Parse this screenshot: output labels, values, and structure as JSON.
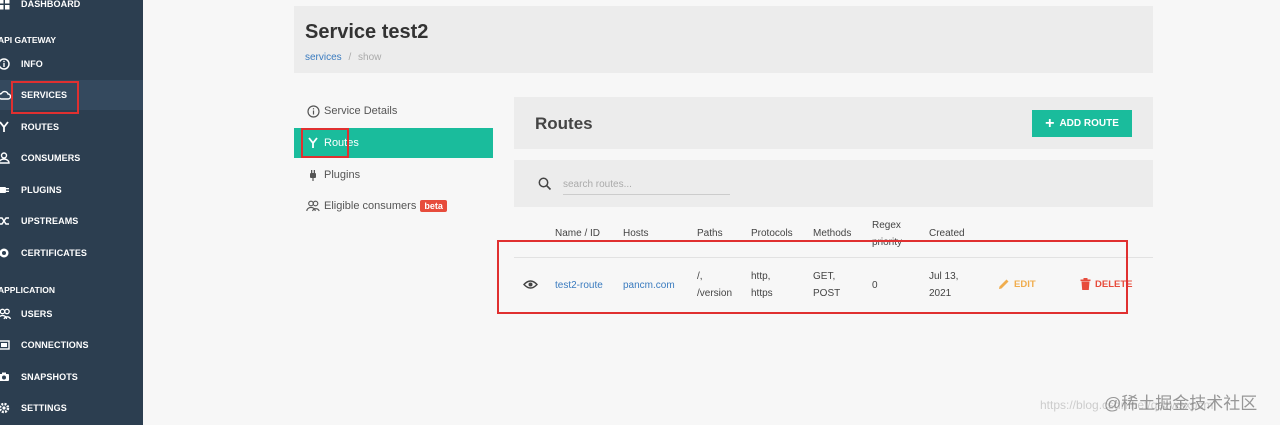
{
  "sidebar": {
    "items": [
      {
        "label": "DASHBOARD"
      },
      {
        "label": "INFO"
      },
      {
        "label": "SERVICES"
      },
      {
        "label": "ROUTES"
      },
      {
        "label": "CONSUMERS"
      },
      {
        "label": "PLUGINS"
      },
      {
        "label": "UPSTREAMS"
      },
      {
        "label": "CERTIFICATES"
      },
      {
        "label": "USERS"
      },
      {
        "label": "CONNECTIONS"
      },
      {
        "label": "SNAPSHOTS"
      },
      {
        "label": "SETTINGS"
      }
    ],
    "sections": {
      "api_gateway": "API GATEWAY",
      "application": "APPLICATION"
    }
  },
  "header": {
    "title": "Service test2",
    "breadcrumb": {
      "link": "services",
      "separator": "/",
      "current": "show"
    }
  },
  "tabs": [
    {
      "label": "Service Details"
    },
    {
      "label": "Routes"
    },
    {
      "label": "Plugins"
    },
    {
      "label": "Eligible consumers",
      "badge": "beta"
    }
  ],
  "routes": {
    "title": "Routes",
    "add_button": "ADD ROUTE",
    "search_placeholder": "search routes...",
    "columns": {
      "name": "Name / ID",
      "hosts": "Hosts",
      "paths": "Paths",
      "protocols": "Protocols",
      "methods": "Methods",
      "regex_1": "Regex",
      "regex_2": "priority",
      "created": "Created"
    },
    "rows": [
      {
        "name": "test2-route",
        "hosts": "pancm.com",
        "paths_1": "/,",
        "paths_2": "/version",
        "protocols_1": "http,",
        "protocols_2": "https",
        "methods_1": "GET,",
        "methods_2": "POST",
        "regex": "0",
        "created_1": "Jul 13,",
        "created_2": "2021",
        "edit": "EDIT",
        "delete": "DELETE"
      }
    ]
  },
  "watermark": {
    "text": "@稀土掘金技术社区",
    "url": "https://blog.csdn.net/qazwsxpcm"
  },
  "colors": {
    "sidebar_bg": "#2c3e50",
    "accent": "#1abc9c",
    "link": "#3a7bbf",
    "edit": "#f0ad4e",
    "delete": "#e74c3c",
    "annotation": "#e03030"
  }
}
